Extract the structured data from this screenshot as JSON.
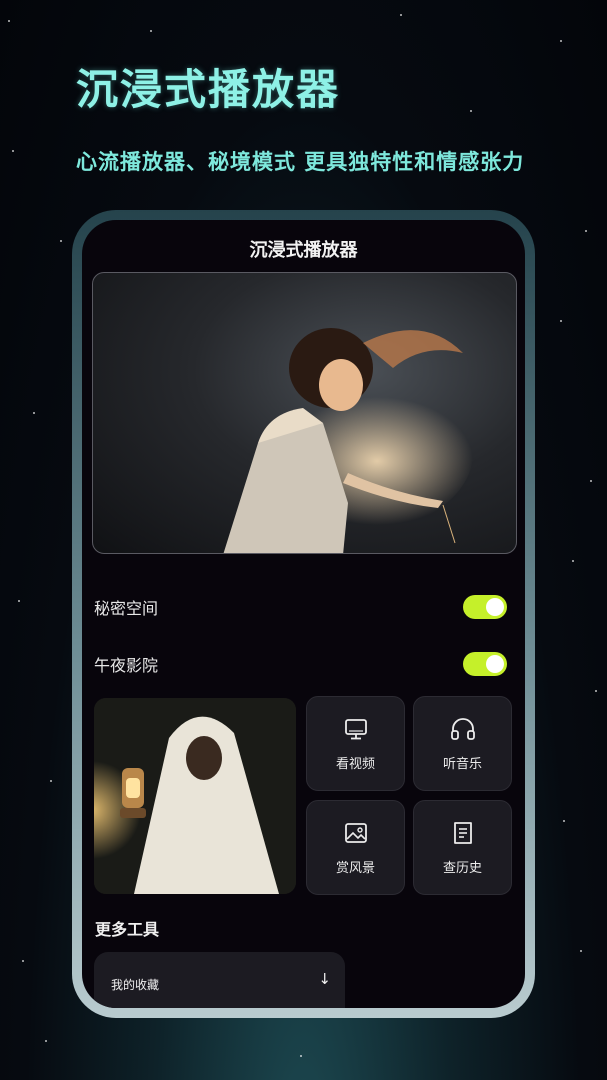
{
  "promo": {
    "title": "沉浸式播放器",
    "subtitle": "心流播放器、秘境模式 更具独特性和情感张力"
  },
  "app": {
    "title": "沉浸式播放器"
  },
  "settings": [
    {
      "label": "秘密空间",
      "enabled": true
    },
    {
      "label": "午夜影院",
      "enabled": true
    }
  ],
  "tiles": [
    {
      "label": "看视频",
      "icon": "monitor-icon"
    },
    {
      "label": "听音乐",
      "icon": "headphones-icon"
    },
    {
      "label": "赏风景",
      "icon": "landscape-icon"
    },
    {
      "label": "查历史",
      "icon": "history-document-icon"
    }
  ],
  "more_tools": {
    "title": "更多工具",
    "items": [
      {
        "label": "我的收藏",
        "arrow": "↓"
      }
    ]
  },
  "colors": {
    "accent_text": "#8ef1e6",
    "toggle_on": "#c5f02a",
    "screen_bg": "#08050c",
    "tile_bg": "#1c1b22"
  }
}
